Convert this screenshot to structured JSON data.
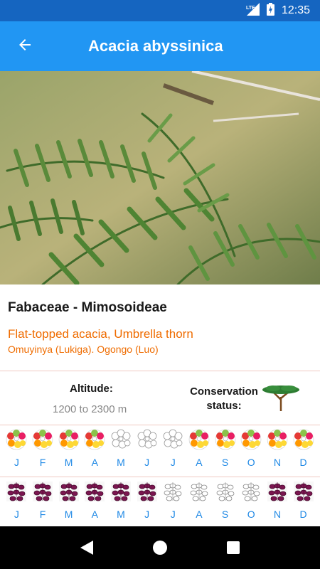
{
  "status_bar": {
    "time": "12:35",
    "network": "LTE",
    "icons": [
      "lte-signal-icon",
      "battery-charging-icon"
    ]
  },
  "app_bar": {
    "title": "Acacia abyssinica",
    "back_icon": "arrow-back-icon"
  },
  "hero_image": {
    "subject": "acacia-foliage-photo"
  },
  "names": {
    "family": "Fabaceae - Mimosoideae",
    "common": "Flat-topped acacia, Umbrella thorn",
    "local": "Omuyinya (Lukiga). Ogongo (Luo)"
  },
  "info": {
    "altitude_label": "Altitude:",
    "altitude_value": "1200 to 2300 m",
    "conservation_label": "Conservation status:",
    "conservation_icon": "flat-top-tree-icon"
  },
  "flowering_calendar": {
    "months": [
      {
        "label": "J",
        "active": true
      },
      {
        "label": "F",
        "active": true
      },
      {
        "label": "M",
        "active": true
      },
      {
        "label": "A",
        "active": true
      },
      {
        "label": "M",
        "active": false
      },
      {
        "label": "J",
        "active": false
      },
      {
        "label": "J",
        "active": false
      },
      {
        "label": "A",
        "active": true
      },
      {
        "label": "S",
        "active": true
      },
      {
        "label": "O",
        "active": true
      },
      {
        "label": "N",
        "active": true
      },
      {
        "label": "D",
        "active": true
      }
    ]
  },
  "fruiting_calendar": {
    "months": [
      {
        "label": "J",
        "active": true
      },
      {
        "label": "F",
        "active": true
      },
      {
        "label": "M",
        "active": true
      },
      {
        "label": "A",
        "active": true
      },
      {
        "label": "M",
        "active": true
      },
      {
        "label": "J",
        "active": true
      },
      {
        "label": "J",
        "active": false
      },
      {
        "label": "A",
        "active": false
      },
      {
        "label": "S",
        "active": false
      },
      {
        "label": "O",
        "active": false
      },
      {
        "label": "N",
        "active": true
      },
      {
        "label": "D",
        "active": true
      }
    ]
  },
  "nav_bar": {
    "back": "nav-back-icon",
    "home": "nav-home-icon",
    "recents": "nav-recents-icon"
  },
  "colors": {
    "status_bar": "#1565C0",
    "app_bar": "#2196F3",
    "accent_orange": "#ef6c00",
    "month_label": "#1e88e5",
    "divider": "#f0c9c2"
  }
}
